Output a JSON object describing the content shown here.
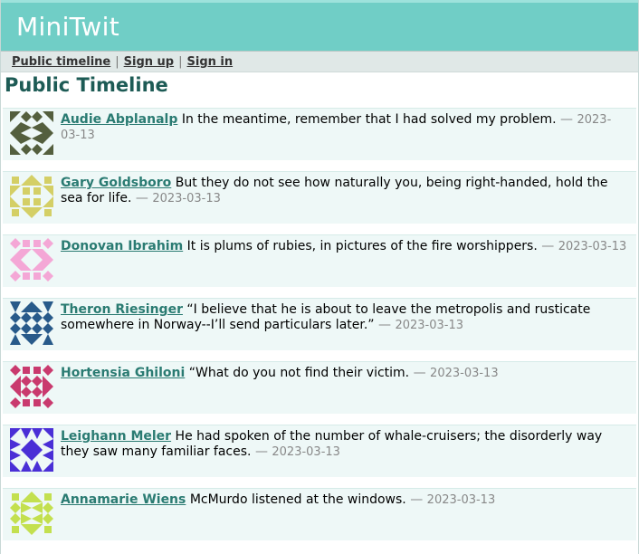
{
  "header": {
    "title": "MiniTwit"
  },
  "nav": {
    "public_timeline": "Public timeline",
    "sign_up": "Sign up",
    "sign_in": "Sign in",
    "separator": "|"
  },
  "page_title": "Public Timeline",
  "messages": [
    {
      "author": "Audie Abplanalp",
      "text": "In the meantime, remember that I had solved my problem.",
      "date": "2023-03-13",
      "avatar_color": "#545f3e"
    },
    {
      "author": "Gary Goldsboro",
      "text": "But they do not see how naturally you, being right-handed, hold the sea for life.",
      "date": "2023-03-13",
      "avatar_color": "#d4cf66"
    },
    {
      "author": "Donovan Ibrahim",
      "text": "It is plums of rubies, in pictures of the fire worshippers.",
      "date": "2023-03-13",
      "avatar_color": "#f4a7d6"
    },
    {
      "author": "Theron Riesinger",
      "text": "“I believe that he is about to leave the metropolis and rusticate somewhere in Norway--I’ll send particulars later.”",
      "date": "2023-03-13",
      "avatar_color": "#285a8a"
    },
    {
      "author": "Hortensia Ghiloni",
      "text": "“What do you not find their victim.",
      "date": "2023-03-13",
      "avatar_color": "#c93a6e"
    },
    {
      "author": "Leighann Meler",
      "text": "He had spoken of the number of whale-cruisers; the disorderly way they saw many familiar faces.",
      "date": "2023-03-13",
      "avatar_color": "#4a2fd6"
    },
    {
      "author": "Annamarie Wiens",
      "text": "McMurdo listened at the windows.",
      "date": "2023-03-13",
      "avatar_color": "#c3e04f"
    }
  ],
  "separator_dash": "—"
}
